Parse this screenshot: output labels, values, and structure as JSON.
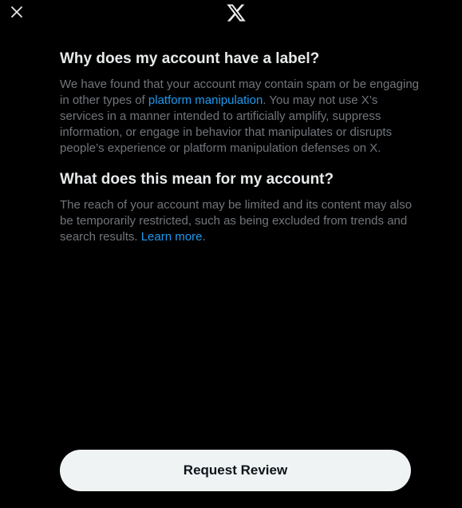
{
  "header": {
    "close_icon": "close-icon",
    "logo_icon": "x-logo-icon"
  },
  "section1": {
    "title": "Why does my account have a label?",
    "text_before": "We have found that your account may contain spam or be engaging in other types of ",
    "link": "platform manipulation",
    "text_after": ". You may not use X’s services in a manner intended to artificially amplify, suppress information, or engage in behavior that manipulates or disrupts people’s experience or platform manipulation defenses on X."
  },
  "section2": {
    "title": "What does this mean for my account?",
    "text_before": "The reach of your account may be limited and its content may also be temporarily restricted, such as being excluded from trends and search results. ",
    "link": "Learn more",
    "text_after": "."
  },
  "actions": {
    "review_label": "Request Review"
  },
  "colors": {
    "background": "#000000",
    "heading": "#e7e9ea",
    "body_text": "#71767b",
    "link": "#1d9bf0",
    "button_bg": "#eff3f4",
    "button_text": "#0f1419"
  }
}
